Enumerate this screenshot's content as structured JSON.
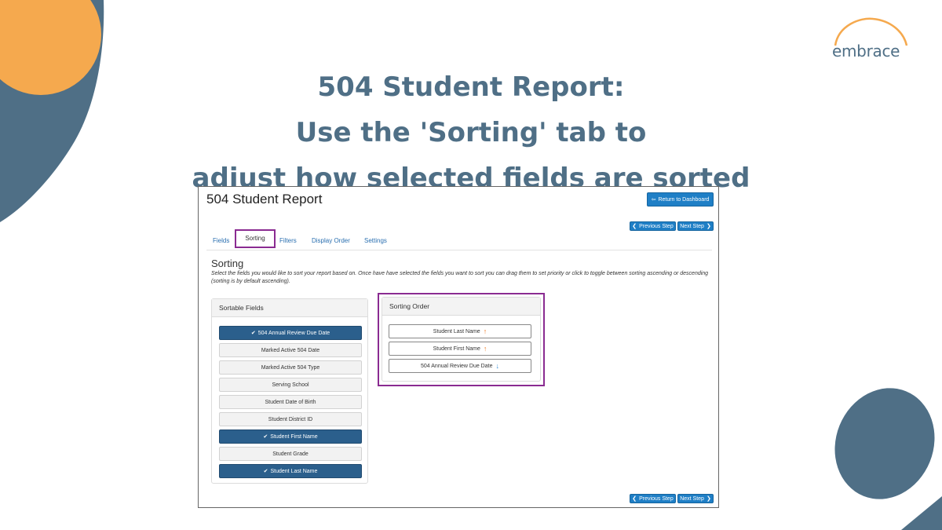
{
  "slide": {
    "title_line1": "504 Student Report:",
    "title_line2": "Use the 'Sorting' tab to",
    "title_line3": "adjust how selected fields are sorted"
  },
  "logo": {
    "text": "embrace",
    "color": "#f5a94e"
  },
  "colors": {
    "accent_blue": "#4f6f86",
    "accent_orange": "#f5a94e",
    "highlight_purple": "#8a2b91",
    "button_blue": "#1f7fc6"
  },
  "report": {
    "title": "504 Student Report",
    "return_button": "Return to Dashboard",
    "prev_button": "Previous Step",
    "next_button": "Next Step",
    "tabs": [
      "Fields",
      "Sorting",
      "Filters",
      "Display Order",
      "Settings"
    ],
    "active_tab": "Sorting",
    "section_title": "Sorting",
    "section_desc": "Select the fields you would like to sort your report based on. Once have have selected the fields you want to sort you can drag them to set priority or click to toggle between sorting ascending or descending (sorting is by default ascending).",
    "sortable_fields": {
      "header": "Sortable Fields",
      "items": [
        {
          "label": "504 Annual Review Due Date",
          "selected": true
        },
        {
          "label": "Marked Active 504 Date",
          "selected": false
        },
        {
          "label": "Marked Active 504 Type",
          "selected": false
        },
        {
          "label": "Serving School",
          "selected": false
        },
        {
          "label": "Student Date of Birth",
          "selected": false
        },
        {
          "label": "Student District ID",
          "selected": false
        },
        {
          "label": "Student First Name",
          "selected": true
        },
        {
          "label": "Student Grade",
          "selected": false
        },
        {
          "label": "Student Last Name",
          "selected": true
        }
      ]
    },
    "sorting_order": {
      "header": "Sorting Order",
      "items": [
        {
          "label": "Student Last Name",
          "direction": "ascending"
        },
        {
          "label": "Student First Name",
          "direction": "ascending"
        },
        {
          "label": "504 Annual Review Due Date",
          "direction": "descending"
        }
      ]
    }
  }
}
